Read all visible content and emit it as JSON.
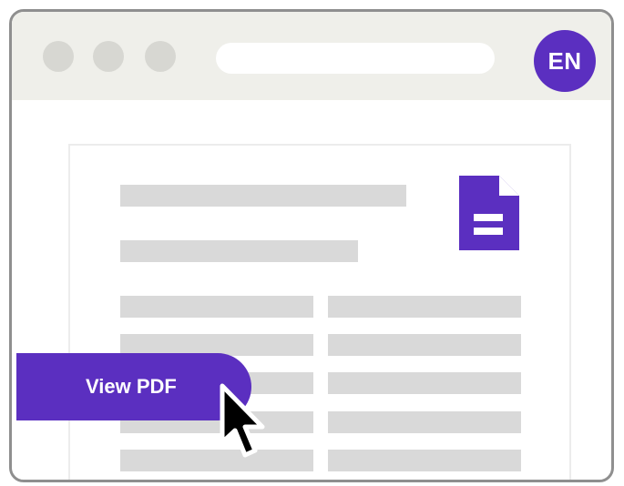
{
  "header": {
    "language_badge": "EN"
  },
  "button": {
    "view_pdf_label": "View PDF"
  },
  "icons": {
    "document": "document-icon",
    "cursor": "pointer-cursor-icon"
  },
  "colors": {
    "accent": "#5b2fc0",
    "placeholder": "#d9d9d9",
    "titlebar": "#efefea"
  }
}
